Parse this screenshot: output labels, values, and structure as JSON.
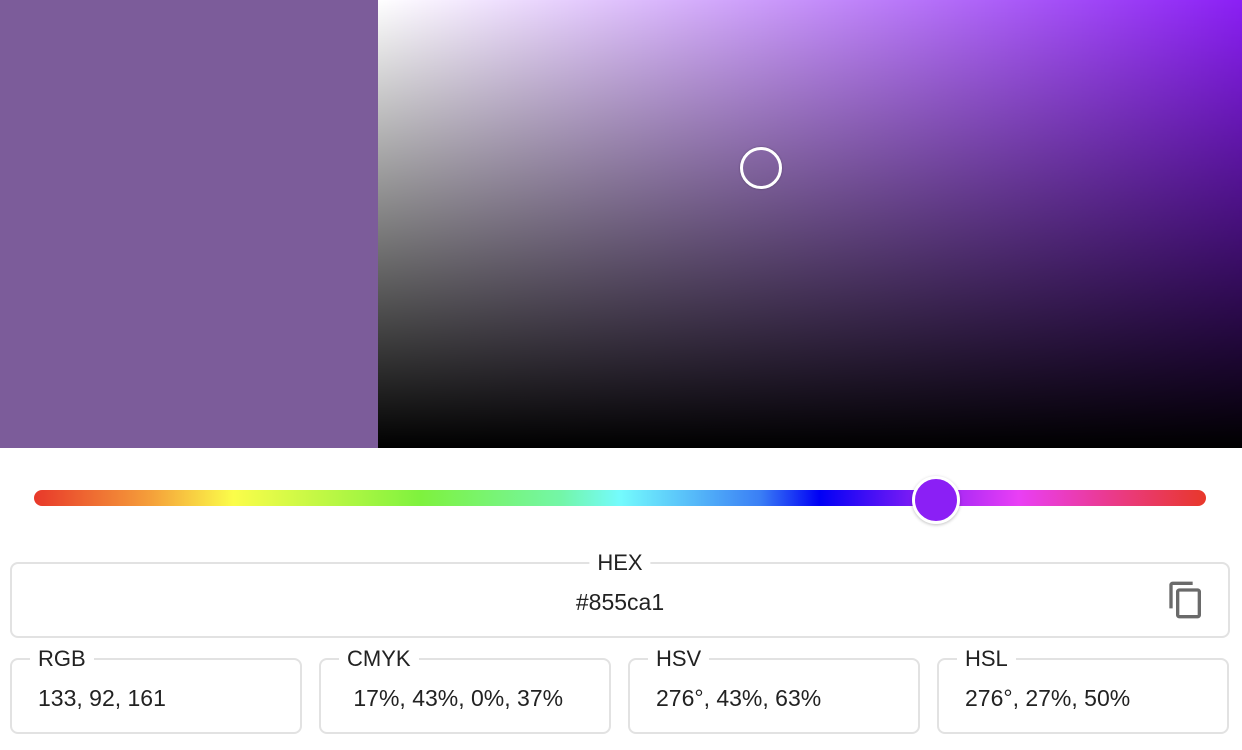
{
  "color": {
    "current_hex": "#7c5c9a",
    "hue_hex": "#8b1ff5"
  },
  "hex": {
    "label": "HEX",
    "value": "#855ca1"
  },
  "formats": [
    {
      "label": "RGB",
      "value": "133, 92, 161"
    },
    {
      "label": "CMYK",
      "value": " 17%, 43%, 0%, 37%"
    },
    {
      "label": "HSV",
      "value": "276°, 43%, 63%"
    },
    {
      "label": "HSL",
      "value": "276°, 27%, 50%"
    }
  ],
  "icons": {
    "copy": "copy-icon"
  }
}
